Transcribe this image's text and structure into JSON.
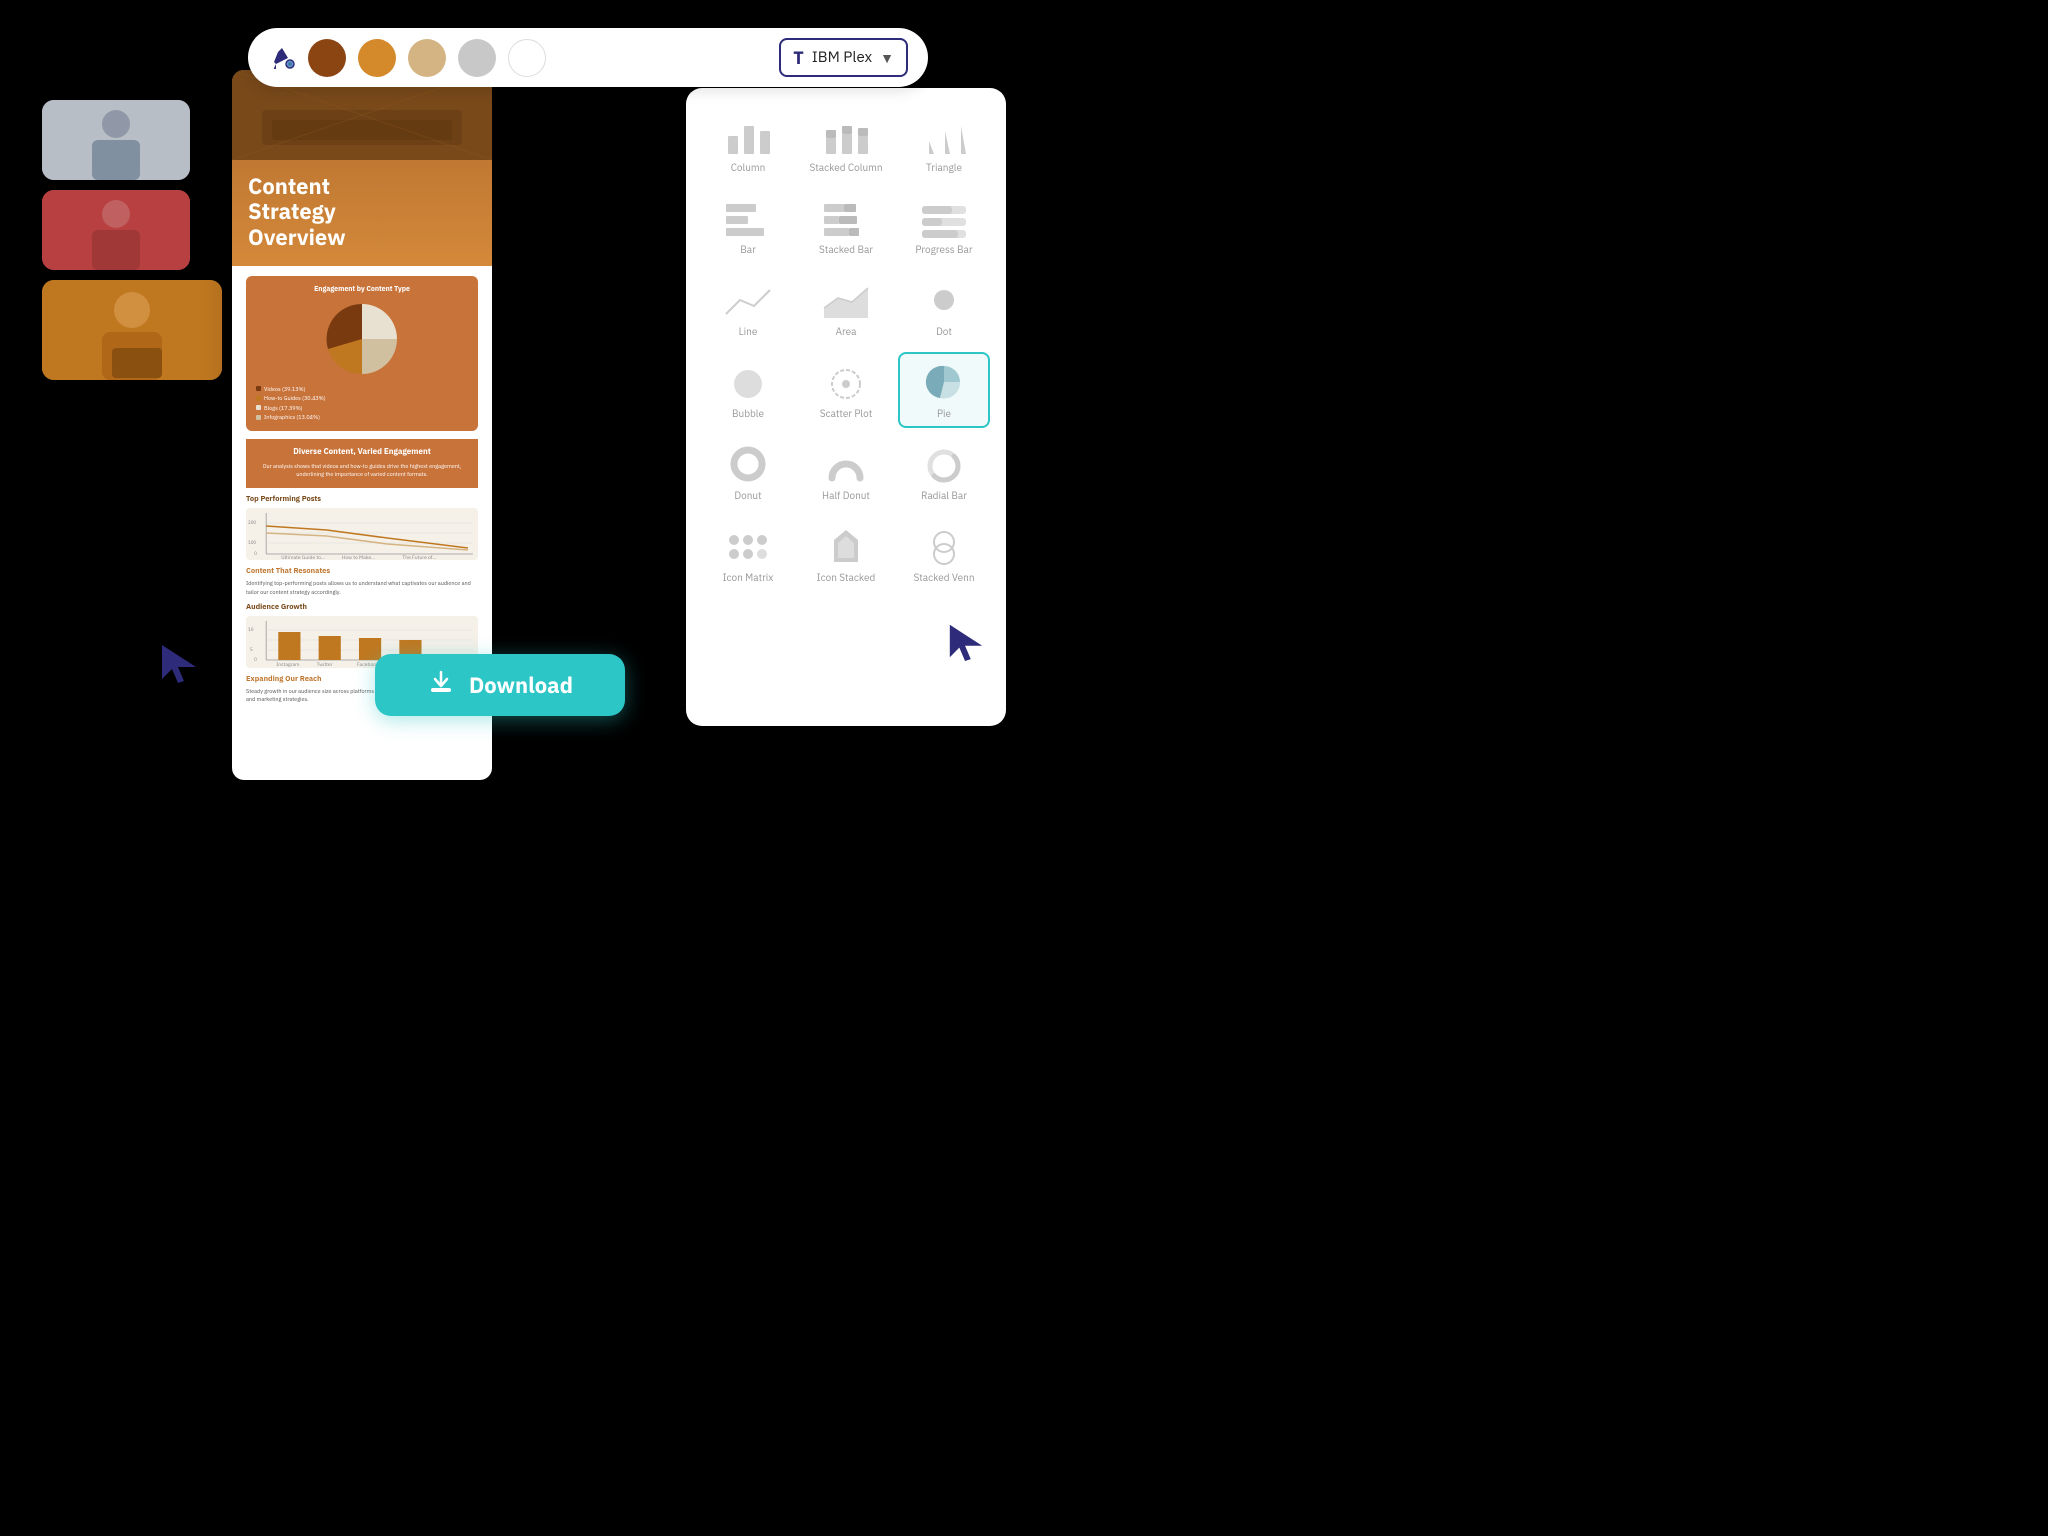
{
  "toolbar": {
    "font_label": "IBM Plex",
    "colors": [
      {
        "name": "brown-dark",
        "hex": "#8B4513"
      },
      {
        "name": "orange-medium",
        "hex": "#D4892A"
      },
      {
        "name": "tan-light",
        "hex": "#D4B483"
      },
      {
        "name": "gray-light",
        "hex": "#C8C8C8"
      },
      {
        "name": "white",
        "hex": "#FFFFFF"
      }
    ]
  },
  "doc": {
    "title": "Content\nStrategy\nOverview",
    "pie_chart_title": "Engagement by Content Type",
    "pie_legend": [
      {
        "label": "Videos (39.13%)",
        "color": "#7a3a10"
      },
      {
        "label": "How-to Guides (30.43%)",
        "color": "#c07820"
      },
      {
        "label": "Blogs (17.39%)",
        "color": "#e8e0d0"
      },
      {
        "label": "Infographics (13.04%)",
        "color": "#d0c0a0"
      }
    ],
    "diverse_title": "Diverse Content, Varied Engagement",
    "diverse_text": "Our analysis shows that videos and how-to guides drive the highest engagement, underlining the importance of varied content formats.",
    "top_posts_heading": "Top Performing Posts",
    "content_resonates_heading": "Content That Resonates",
    "content_resonates_text": "Identifying top-performing posts allows us to understand what captivates our audience and tailor our content strategy accordingly.",
    "audience_growth_heading": "Audience Growth",
    "expanding_heading": "Expanding Our Reach",
    "expanding_text": "Steady growth in our audience size across platforms indicates effective content distribution and marketing strategies."
  },
  "chart_panel": {
    "items": [
      {
        "id": "column",
        "label": "Column",
        "selected": false
      },
      {
        "id": "stacked-column",
        "label": "Stacked Column",
        "selected": false
      },
      {
        "id": "triangle",
        "label": "Triangle",
        "selected": false
      },
      {
        "id": "bar",
        "label": "Bar",
        "selected": false
      },
      {
        "id": "stacked-bar",
        "label": "Stacked Bar",
        "selected": false
      },
      {
        "id": "progress-bar",
        "label": "Progress Bar",
        "selected": false
      },
      {
        "id": "line",
        "label": "Line",
        "selected": false
      },
      {
        "id": "area",
        "label": "Area",
        "selected": false
      },
      {
        "id": "dot",
        "label": "Dot",
        "selected": false
      },
      {
        "id": "bubble",
        "label": "Bubble",
        "selected": false
      },
      {
        "id": "scatter-plot",
        "label": "Scatter Plot",
        "selected": false
      },
      {
        "id": "pie",
        "label": "Pie",
        "selected": true
      },
      {
        "id": "donut",
        "label": "Donut",
        "selected": false
      },
      {
        "id": "half-donut",
        "label": "Half Donut",
        "selected": false
      },
      {
        "id": "radial-bar",
        "label": "Radial Bar",
        "selected": false
      },
      {
        "id": "icon-matrix",
        "label": "Icon Matrix",
        "selected": false
      },
      {
        "id": "icon-stacked",
        "label": "Icon Stacked",
        "selected": false
      },
      {
        "id": "stacked-venn",
        "label": "Stacked Venn",
        "selected": false
      }
    ]
  },
  "download": {
    "label": "Download"
  }
}
